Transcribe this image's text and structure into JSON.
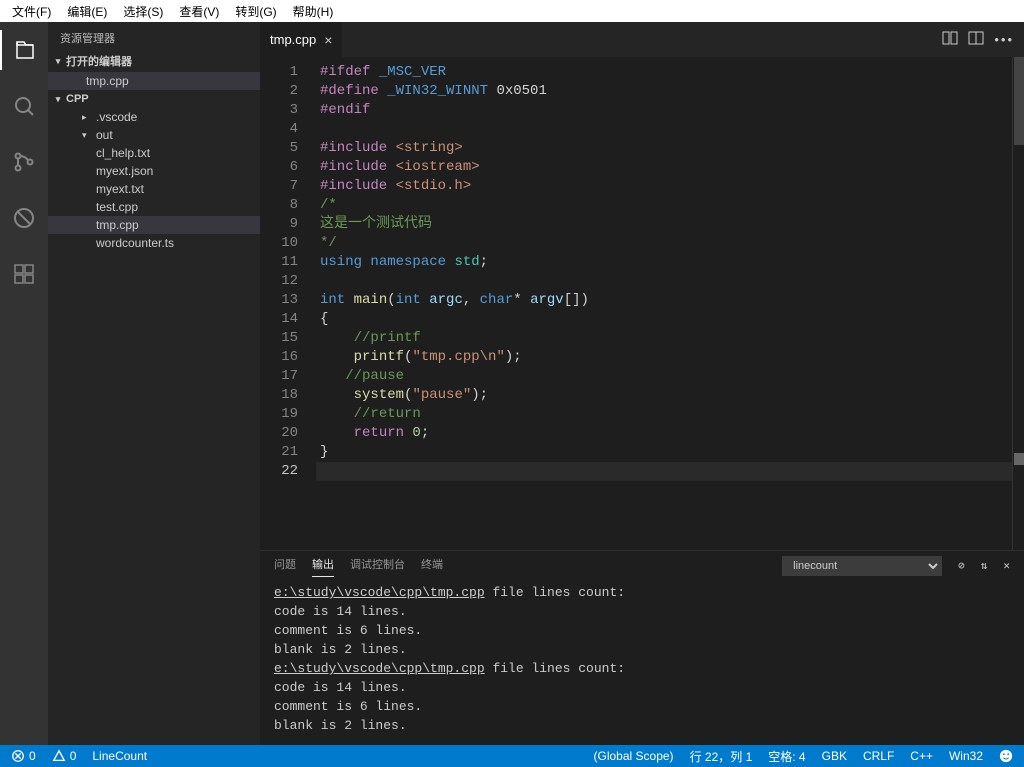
{
  "menu": [
    "文件(F)",
    "编辑(E)",
    "选择(S)",
    "查看(V)",
    "转到(G)",
    "帮助(H)"
  ],
  "sidebar": {
    "title": "资源管理器",
    "openEditors": "打开的编辑器",
    "openEditorItems": [
      "tmp.cpp"
    ],
    "rootName": "CPP",
    "tree": [
      {
        "label": ".vscode",
        "kind": "folder",
        "open": false,
        "indent": 1
      },
      {
        "label": "out",
        "kind": "folder",
        "open": true,
        "indent": 1
      },
      {
        "label": "cl_help.txt",
        "kind": "file",
        "indent": 2
      },
      {
        "label": "myext.json",
        "kind": "file",
        "indent": 2
      },
      {
        "label": "myext.txt",
        "kind": "file",
        "indent": 2
      },
      {
        "label": "test.cpp",
        "kind": "file",
        "indent": 2
      },
      {
        "label": "tmp.cpp",
        "kind": "file",
        "indent": 2,
        "selected": true
      },
      {
        "label": "wordcounter.ts",
        "kind": "file",
        "indent": 2
      }
    ]
  },
  "tab": {
    "name": "tmp.cpp"
  },
  "code": [
    [
      {
        "t": "#ifdef ",
        "c": "pp"
      },
      {
        "t": "_MSC_VER",
        "c": "mac"
      }
    ],
    [
      {
        "t": "#define ",
        "c": "pp"
      },
      {
        "t": "_WIN32_WINNT",
        "c": "mac"
      },
      {
        "t": " 0x0501",
        "c": ""
      }
    ],
    [
      {
        "t": "#endif",
        "c": "pp"
      }
    ],
    [],
    [
      {
        "t": "#include ",
        "c": "pp"
      },
      {
        "t": "<string>",
        "c": "str"
      }
    ],
    [
      {
        "t": "#include ",
        "c": "pp"
      },
      {
        "t": "<iostream>",
        "c": "str"
      }
    ],
    [
      {
        "t": "#include ",
        "c": "pp"
      },
      {
        "t": "<stdio.h>",
        "c": "str"
      }
    ],
    [
      {
        "t": "/*",
        "c": "cm"
      }
    ],
    [
      {
        "t": "这是一个测试代码",
        "c": "cm"
      }
    ],
    [
      {
        "t": "*/",
        "c": "cm"
      }
    ],
    [
      {
        "t": "using ",
        "c": "kw"
      },
      {
        "t": "namespace ",
        "c": "kw"
      },
      {
        "t": "std",
        "c": "ty"
      },
      {
        "t": ";",
        "c": ""
      }
    ],
    [],
    [
      {
        "t": "int ",
        "c": "kw"
      },
      {
        "t": "main",
        "c": "fn"
      },
      {
        "t": "(",
        "c": ""
      },
      {
        "t": "int ",
        "c": "kw"
      },
      {
        "t": "argc",
        "c": "id"
      },
      {
        "t": ", ",
        "c": ""
      },
      {
        "t": "char",
        "c": "kw"
      },
      {
        "t": "* ",
        "c": ""
      },
      {
        "t": "argv",
        "c": "id"
      },
      {
        "t": "[])",
        "c": ""
      }
    ],
    [
      {
        "t": "{",
        "c": ""
      }
    ],
    [
      {
        "t": "    ",
        "c": ""
      },
      {
        "t": "//printf",
        "c": "cm"
      }
    ],
    [
      {
        "t": "    ",
        "c": ""
      },
      {
        "t": "printf",
        "c": "fn"
      },
      {
        "t": "(",
        "c": ""
      },
      {
        "t": "\"tmp.cpp\\n\"",
        "c": "str"
      },
      {
        "t": ");",
        "c": ""
      }
    ],
    [
      {
        "t": "   ",
        "c": ""
      },
      {
        "t": "//pause",
        "c": "cm"
      }
    ],
    [
      {
        "t": "    ",
        "c": ""
      },
      {
        "t": "system",
        "c": "fn"
      },
      {
        "t": "(",
        "c": ""
      },
      {
        "t": "\"pause\"",
        "c": "str"
      },
      {
        "t": ");",
        "c": ""
      }
    ],
    [
      {
        "t": "    ",
        "c": ""
      },
      {
        "t": "//return",
        "c": "cm"
      }
    ],
    [
      {
        "t": "    ",
        "c": ""
      },
      {
        "t": "return ",
        "c": "pp"
      },
      {
        "t": "0",
        "c": "num"
      },
      {
        "t": ";",
        "c": ""
      }
    ],
    [
      {
        "t": "}",
        "c": ""
      }
    ],
    []
  ],
  "currentLine": 22,
  "panel": {
    "tabs": [
      "问题",
      "输出",
      "调试控制台",
      "终端"
    ],
    "activeTab": 1,
    "dropdown": "linecount",
    "output": [
      {
        "t": "e:\\study\\vscode\\cpp\\tmp.cpp",
        "u": true,
        "rest": " file lines count:"
      },
      {
        "t": "   code is 14 lines."
      },
      {
        "t": "   comment is 6 lines."
      },
      {
        "t": "   blank is 2 lines."
      },
      {
        "t": "e:\\study\\vscode\\cpp\\tmp.cpp",
        "u": true,
        "rest": " file lines count:"
      },
      {
        "t": "   code is 14 lines."
      },
      {
        "t": "   comment is 6 lines."
      },
      {
        "t": "   blank is 2 lines."
      }
    ]
  },
  "status": {
    "errors": "0",
    "warnings": "0",
    "linecount": "LineCount",
    "scope": "(Global Scope)",
    "lncol": "行 22，列 1",
    "spaces": "空格: 4",
    "encoding": "GBK",
    "eol": "CRLF",
    "lang": "C++",
    "config": "Win32"
  }
}
